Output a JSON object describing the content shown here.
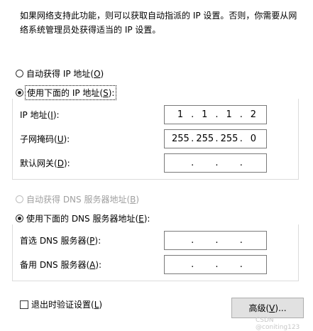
{
  "intro": {
    "line1": "如果网络支持此功能，则可以获取自动指派的 IP 设置。否则，你需要从网",
    "line2": "络系统管理员处获得适当的 IP 设置。"
  },
  "ip_section": {
    "auto_label": "自动获得 IP 地址(",
    "auto_key": "O",
    "auto_end": ")",
    "manual_label": "使用下面的 IP 地址(",
    "manual_key": "S",
    "manual_end": "):",
    "ip_label": "IP 地址(",
    "ip_key": "I",
    "ip_end": "):",
    "ip_value": [
      "1",
      "1",
      "1",
      "2"
    ],
    "mask_label": "子网掩码(",
    "mask_key": "U",
    "mask_end": "):",
    "mask_value": [
      "255",
      "255",
      "255",
      "0"
    ],
    "gw_label": "默认网关(",
    "gw_key": "D",
    "gw_end": "):",
    "gw_value": [
      "",
      "",
      "",
      ""
    ]
  },
  "dns_section": {
    "auto_label": "自动获得 DNS 服务器地址(",
    "auto_key": "B",
    "auto_end": ")",
    "manual_label": "使用下面的 DNS 服务器地址(",
    "manual_key": "E",
    "manual_end": "):",
    "preferred_label": "首选 DNS 服务器(",
    "preferred_key": "P",
    "preferred_end": "):",
    "preferred_value": [
      "",
      "",
      "",
      ""
    ],
    "alternate_label": "备用 DNS 服务器(",
    "alternate_key": "A",
    "alternate_end": "):",
    "alternate_value": [
      "",
      "",
      "",
      ""
    ]
  },
  "footer": {
    "validate_label": "退出时验证设置(",
    "validate_key": "L",
    "validate_end": ")",
    "advanced_label": "高级(",
    "advanced_key": "V",
    "advanced_end": ")..."
  },
  "watermark": "CSDN @coniting123"
}
